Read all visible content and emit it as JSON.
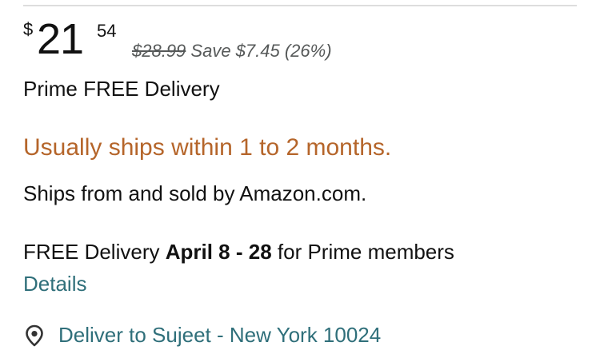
{
  "price": {
    "currency_symbol": "$",
    "whole": "21",
    "fraction": "54",
    "was_price": "$28.99",
    "savings": "Save $7.45 (26%)"
  },
  "delivery": {
    "prime_line": "Prime FREE Delivery",
    "availability": "Usually ships within 1 to 2 months.",
    "sold_by": "Ships from and sold by Amazon.com.",
    "free_delivery_prefix": "FREE Delivery",
    "free_delivery_dates": "April 8 - 28",
    "free_delivery_suffix": "for Prime members",
    "details_link": "Details",
    "deliver_to": "Deliver to Sujeet - New York 10024"
  },
  "icons": {
    "location": "map-pin-icon"
  },
  "colors": {
    "availability": "#b5652a",
    "link": "#2f6f7a",
    "strikethrough_text": "#565959"
  }
}
